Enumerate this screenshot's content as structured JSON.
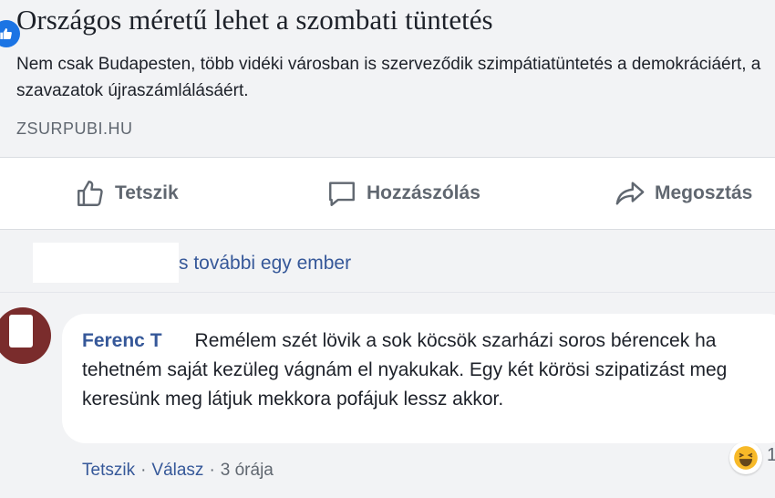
{
  "link_preview": {
    "title": "Országos méretű lehet a szombati tüntetés",
    "description": "Nem csak Budapesten, több vidéki városban is szerveződik szimpátiatüntetés a demokráciáért, a szavazatok újraszámlálásáért.",
    "domain": "ZSURPUBI.HU"
  },
  "actions": {
    "like": "Tetszik",
    "comment": "Hozzászólás",
    "share": "Megosztás"
  },
  "reactions": {
    "text": "s további egy ember",
    "like_icon": "thumbs-up-icon"
  },
  "comment": {
    "author": "Ferenc T",
    "text": "Remélem szét lövik a sok köcsök szarházi soros bérencek ha tehetném saját kezüleg vágnám el nyakukak. Egy két körösi szipatizást meg keresünk meg látjuk mekkora pofájuk lessz akkor.",
    "like_label": "Tetszik",
    "reply_label": "Válasz",
    "time": "3 órája",
    "separator": "·",
    "reaction_icon": "laughing-emoji-icon",
    "reaction_count": "1"
  },
  "colors": {
    "link": "#365899",
    "muted": "#606770",
    "like_blue": "#1b74e4",
    "card_bg": "#f2f3f5"
  }
}
